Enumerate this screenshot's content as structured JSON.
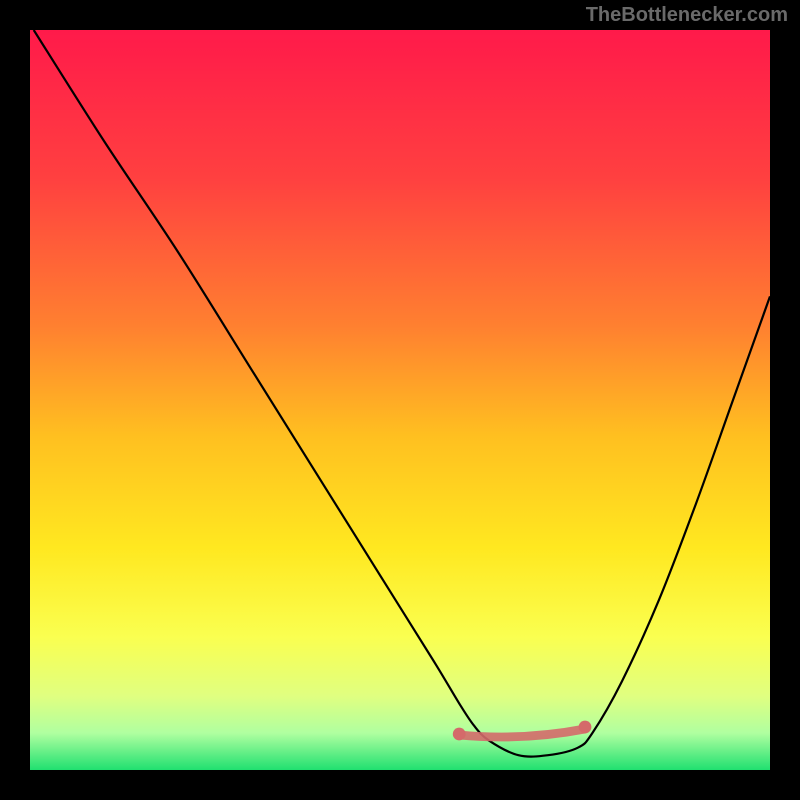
{
  "watermark": "TheBottlenecker.com",
  "chart_data": {
    "type": "line",
    "title": "",
    "xlabel": "",
    "ylabel": "",
    "xlim": [
      0,
      100
    ],
    "ylim": [
      0,
      100
    ],
    "background_gradient": {
      "stops": [
        {
          "offset": 0,
          "color": "#ff1a4a"
        },
        {
          "offset": 20,
          "color": "#ff4040"
        },
        {
          "offset": 40,
          "color": "#ff8030"
        },
        {
          "offset": 55,
          "color": "#ffc020"
        },
        {
          "offset": 70,
          "color": "#ffe820"
        },
        {
          "offset": 82,
          "color": "#faff50"
        },
        {
          "offset": 90,
          "color": "#e0ff80"
        },
        {
          "offset": 95,
          "color": "#b0ffa0"
        },
        {
          "offset": 100,
          "color": "#20e070"
        }
      ]
    },
    "series": [
      {
        "name": "curve",
        "color": "#000000",
        "x": [
          0.5,
          10,
          20,
          30,
          40,
          50,
          55,
          58,
          60,
          62,
          66,
          70,
          74,
          76,
          80,
          85,
          90,
          95,
          100
        ],
        "y": [
          100,
          85,
          70,
          54,
          38,
          22,
          14,
          9,
          6,
          4,
          2,
          2,
          3,
          5,
          12,
          23,
          36,
          50,
          64
        ]
      }
    ],
    "marker_band": {
      "color": "#d46a6a",
      "x_start": 58,
      "x_end": 75,
      "y": 5,
      "thickness": 2.2,
      "end_dot_radius": 1.6
    }
  }
}
